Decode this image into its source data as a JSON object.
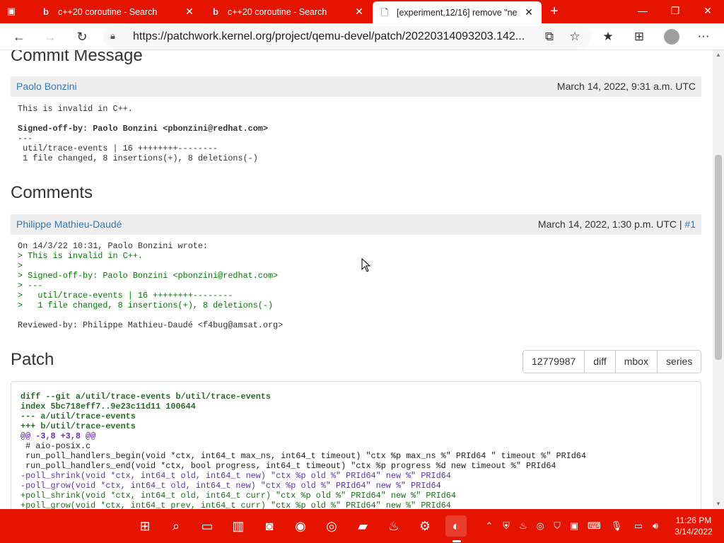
{
  "tabs": [
    {
      "title": "c++20 coroutine - Search",
      "icon": "bing-icon"
    },
    {
      "title": "c++20 coroutine - Search",
      "icon": "bing-icon"
    },
    {
      "title": "[experiment,12/16] remove \"new",
      "icon": "page-icon"
    }
  ],
  "address": {
    "url": "https://patchwork.kernel.org/project/qemu-devel/patch/20220314093203.142..."
  },
  "commit": {
    "heading": "Commit Message",
    "author": "Paolo Bonzini",
    "date": "March 14, 2022, 9:31 a.m. UTC",
    "line1": "This is invalid in C++.",
    "signed": "Signed-off-by: Paolo Bonzini <pbonzini@redhat.com>",
    "sep": "---",
    "stat1": " util/trace-events | 16 ++++++++--------",
    "stat2": " 1 file changed, 8 insertions(+), 8 deletions(-)"
  },
  "comments": {
    "heading": "Comments",
    "author": "Philippe Mathieu-Daudé",
    "date": "March 14, 2022, 1:30 p.m. UTC",
    "date_sep": " | ",
    "anchor": "#1",
    "intro": "On 14/3/22 10:31, Paolo Bonzini wrote:",
    "q1": "> This is invalid in C++.",
    "q2": ">",
    "q3": "> Signed-off-by: Paolo Bonzini <pbonzini@redhat.com>",
    "q4": "> ---",
    "q5": ">   util/trace-events | 16 ++++++++--------",
    "q6": ">   1 file changed, 8 insertions(+), 8 deletions(-)",
    "reviewed": "Reviewed-by: Philippe Mathieu-Daudé <f4bug@amsat.org>"
  },
  "patch": {
    "heading": "Patch",
    "buttons": [
      "12779987",
      "diff",
      "mbox",
      "series"
    ],
    "lines": [
      "diff --git a/util/trace-events b/util/trace-events",
      "index 5bc718eff7..9e23c11d11 100644",
      "--- a/util/trace-events",
      "+++ b/util/trace-events",
      "@@ -3,8 +3,8 @@",
      " # aio-posix.c",
      " run_poll_handlers_begin(void *ctx, int64_t max_ns, int64_t timeout) \"ctx %p max_ns %\" PRId64 \" timeout %\" PRId64",
      " run_poll_handlers_end(void *ctx, bool progress, int64_t timeout) \"ctx %p progress %d new timeout %\" PRId64",
      "-poll_shrink(void *ctx, int64_t old, int64_t new) \"ctx %p old %\" PRId64\" new %\" PRId64",
      "-poll_grow(void *ctx, int64_t old, int64_t new) \"ctx %p old %\" PRId64\" new %\" PRId64",
      "+poll_shrink(void *ctx, int64_t old, int64_t curr) \"ctx %p old %\" PRId64\" new %\" PRId64",
      "+poll_grow(void *ctx, int64_t prev, int64_t curr) \"ctx %p old %\" PRId64\" new %\" PRId64"
    ]
  },
  "clock": {
    "time": "11:26 PM",
    "date": "3/14/2022"
  },
  "colors": {
    "accent": "#e51400",
    "link": "#337ab7",
    "quote": "#007a00"
  }
}
